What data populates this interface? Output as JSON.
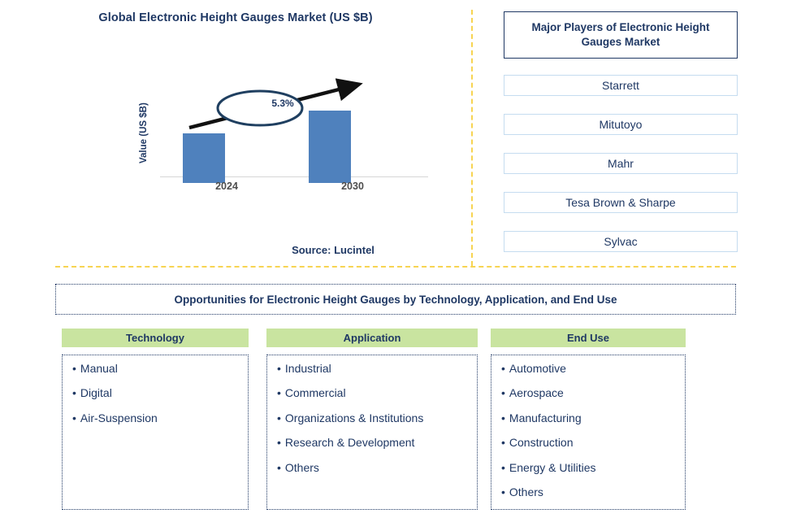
{
  "chart_panel": {
    "title": "Global Electronic Height Gauges Market (US $B)",
    "y_axis_label": "Value (US $B)",
    "cagr_label": "5.3%",
    "source": "Source: Lucintel"
  },
  "chart_data": {
    "type": "bar",
    "title": "Global Electronic Height Gauges Market (US $B)",
    "categories": [
      "2024",
      "2030"
    ],
    "values": [
      61,
      89
    ],
    "xlabel": "",
    "ylabel": "Value (US $B)",
    "ylim": [
      0,
      100
    ],
    "grid": false,
    "legend": "none",
    "bar_color": "#4f81bd",
    "annotations": [
      {
        "text": "5.3%",
        "type": "cagr-callout",
        "shape": "ellipse-with-arrow"
      }
    ],
    "tick_labels": [
      "2024",
      "2030"
    ]
  },
  "players": {
    "header": "Major Players of Electronic Height Gauges Market",
    "items": [
      {
        "label": "Starrett"
      },
      {
        "label": "Mitutoyo"
      },
      {
        "label": "Mahr"
      },
      {
        "label": "Tesa Brown & Sharpe"
      },
      {
        "label": "Sylvac"
      }
    ]
  },
  "opportunities": {
    "banner": "Opportunities for Electronic Height Gauges by Technology, Application, and End Use",
    "columns": [
      {
        "header": "Technology",
        "items": [
          "Manual",
          "Digital",
          "Air-Suspension"
        ]
      },
      {
        "header": "Application",
        "items": [
          "Industrial",
          "Commercial",
          "Organizations & Institutions",
          "Research & Development",
          "Others"
        ]
      },
      {
        "header": "End Use",
        "items": [
          "Automotive",
          "Aerospace",
          "Manufacturing",
          "Construction",
          "Energy & Utilities",
          "Others"
        ]
      }
    ]
  },
  "colors": {
    "navy": "#1f3864",
    "bar_blue": "#4f81bd",
    "divider_gold": "#f7d452",
    "header_green": "#c9e4a0",
    "box_border_blue": "#c5dcf0"
  }
}
